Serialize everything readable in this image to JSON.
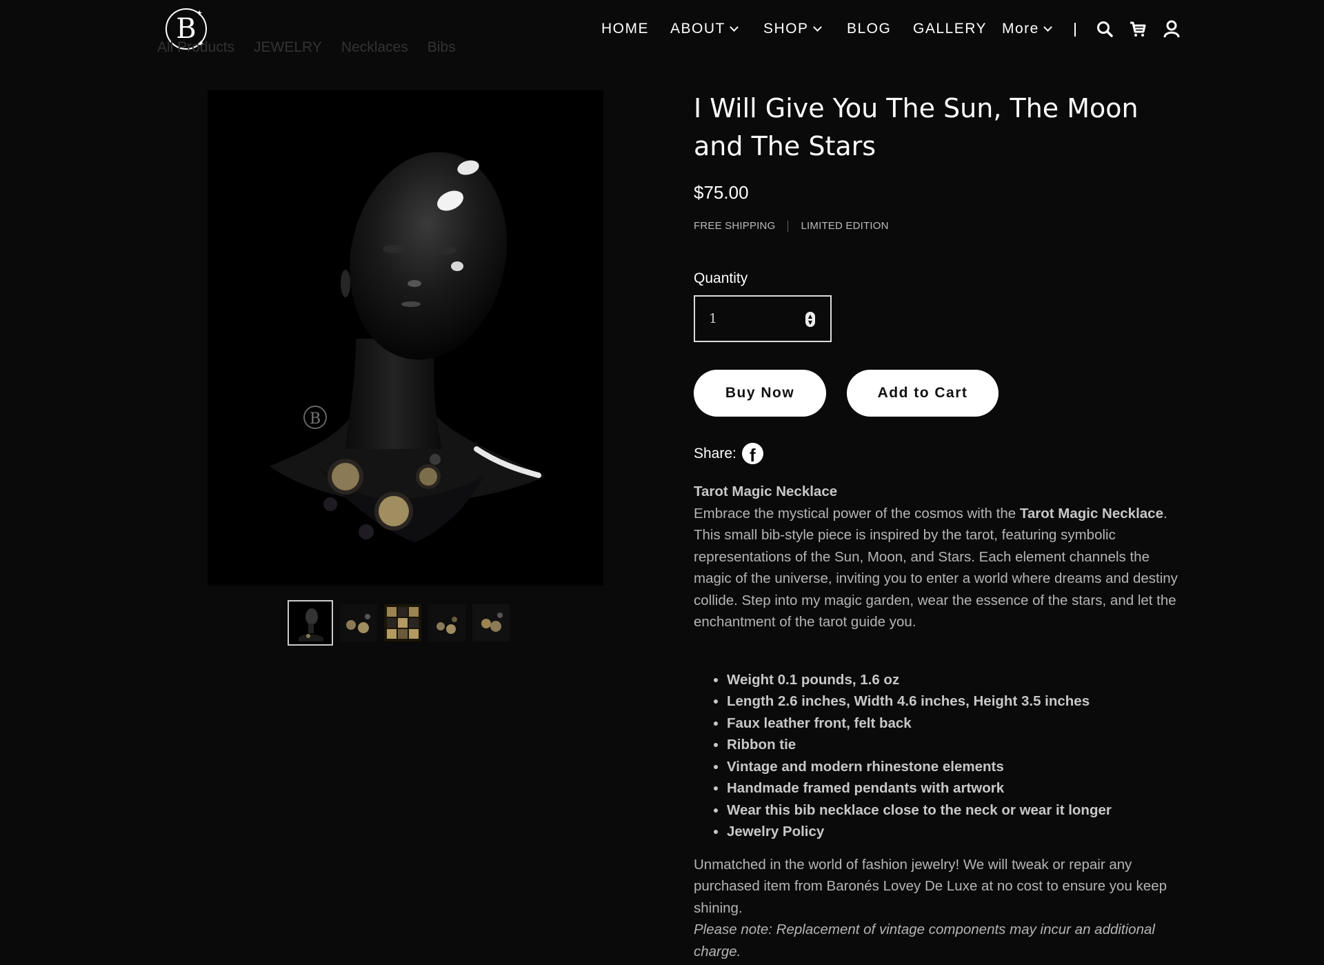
{
  "header": {
    "logo_letter": "B",
    "breadcrumb": [
      "All Products",
      "JEWELRY",
      "Necklaces",
      "Bibs"
    ],
    "nav": [
      {
        "label": "HOME"
      },
      {
        "label": "ABOUT"
      },
      {
        "label": "SHOP"
      },
      {
        "label": "BLOG"
      },
      {
        "label": "GALLERY"
      },
      {
        "label": "More"
      }
    ],
    "icons": [
      "search-icon",
      "cart-icon",
      "account-icon"
    ]
  },
  "gallery": {
    "watermark": "B",
    "thumbnail_count": 5,
    "active_index": 0
  },
  "product": {
    "title": "I Will Give You The Sun, The Moon and The Stars",
    "price": "$75.00",
    "tags": [
      "FREE SHIPPING",
      "LIMITED EDITION"
    ],
    "quantity_label": "Quantity",
    "quantity_value": "1",
    "buy_now": "Buy Now",
    "add_to_cart": "Add to Cart",
    "share_label": "Share:",
    "desc_heading": "Tarot Magic Necklace",
    "desc_intro": "Embrace the mystical power of the cosmos with the ",
    "desc_product_name": "Tarot Magic Necklace",
    "desc_body": ". This small bib-style piece is inspired by the tarot, featuring symbolic representations of the Sun, Moon, and Stars. Each element channels the magic of the universe, inviting you to enter a world where dreams and destiny collide. Step into my magic garden, wear the essence of the stars, and let the enchantment of the tarot guide you.",
    "specs": [
      "Weight 0.1 pounds, 1.6 oz",
      "Length 2.6 inches, Width 4.6 inches, Height 3.5 inches",
      "Faux leather front, felt back",
      "Ribbon tie",
      "Vintage and modern rhinestone elements",
      "Handmade framed pendants with artwork",
      "Wear this bib necklace close to the neck or wear it longer",
      "Jewelry Policy"
    ],
    "policy_text": "Unmatched in the world of fashion jewelry! We will tweak or repair any purchased item from Baronés Lovey De Luxe at no cost to ensure you keep shining.",
    "policy_note": "Please note: Replacement of vintage components may incur an additional charge."
  }
}
